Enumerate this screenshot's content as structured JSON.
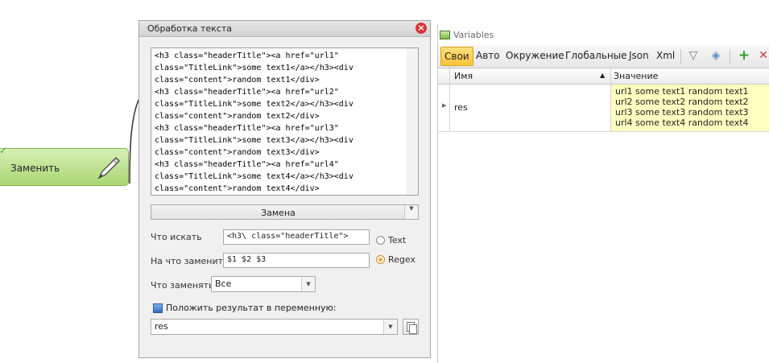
{
  "node": {
    "label": "Заменить",
    "icons": [
      "check-icon",
      "pen-icon"
    ]
  },
  "dialog": {
    "title": "Обработка текста",
    "source_lines": [
      "<h3 class=\"headerTitle\"><a href=\"url1\"",
      "class=\"TitleLink\">some text1</a></h3><div",
      "class=\"content\">random text1</div>",
      "<h3 class=\"headerTitle\"><a href=\"url2\"",
      "class=\"TitleLink\">some text2</a></h3><div",
      "class=\"content\">random text2</div>",
      "<h3 class=\"headerTitle\"><a href=\"url3\"",
      "class=\"TitleLink\">some text3</a></h3><div",
      "class=\"content\">random text3</div>",
      "<h3 class=\"headerTitle\"><a href=\"url4\"",
      "class=\"TitleLink\">some text4</a></h3><div",
      "class=\"content\">random text4</div>"
    ],
    "operation": "Замена",
    "find_label": "Что искать",
    "find_value": "<h3\\ class=\"headerTitle\">",
    "replace_label": "На что заменить",
    "replace_value": "$1 $2 $3",
    "radio_text": "Text",
    "radio_regex": "Regex",
    "selected_mode": "Regex",
    "what_replace_label": "Что заменять",
    "what_replace_value": "Все",
    "save_to_var_label": "Положить результат в переменную:",
    "save_to_var_checked": true,
    "result_var": "res"
  },
  "variables": {
    "title": "Variables",
    "tabs": [
      "Свои",
      "Авто",
      "Окружение",
      "Глобальные",
      "Json",
      "Xml"
    ],
    "active_tab": "Свои",
    "toolbar_icons": [
      "filter-icon",
      "eraser-icon",
      "add-icon",
      "delete-icon"
    ],
    "columns": [
      "Имя",
      "Значение"
    ],
    "rows": [
      {
        "name": "res",
        "value": [
          "url1 some text1 random text1",
          "url2 some text2 random text2",
          "url3 some text3 random text3",
          "url4 some text4 random text4"
        ]
      }
    ]
  },
  "colors": {
    "node_green": "#a9d672",
    "active_tab": "#fbc33a",
    "value_cell": "#ffffc0",
    "close_red": "#d9363e"
  }
}
